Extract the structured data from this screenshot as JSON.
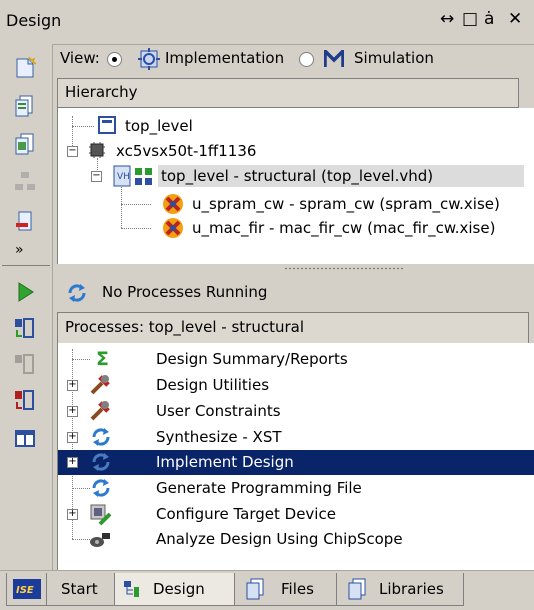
{
  "window": {
    "title": "Design",
    "controls": [
      "↔",
      "□",
      "ȧ",
      "✕"
    ]
  },
  "view": {
    "label": "View:",
    "implementation_label": "Implementation",
    "simulation_label": "Simulation",
    "selected": "Implementation"
  },
  "hierarchy": {
    "header": "Hierarchy",
    "items": [
      {
        "label": "top_level",
        "icon": "document-icon"
      },
      {
        "label": "xc5vsx50t-1ff1136",
        "icon": "chip-icon"
      },
      {
        "label": "top_level - structural (top_level.vhd)",
        "icon": "vhdl-module-icon",
        "selected": true
      },
      {
        "label": "u_spram_cw - spram_cw (spram_cw.xise)",
        "icon": "sysgen-core-icon"
      },
      {
        "label": "u_mac_fir - mac_fir_cw (mac_fir_cw.xise)",
        "icon": "sysgen-core-icon"
      }
    ]
  },
  "processes": {
    "status": "No Processes Running",
    "header": "Processes: top_level - structural",
    "items": [
      {
        "label": "Design Summary/Reports",
        "icon": "sigma-icon",
        "expandable": false
      },
      {
        "label": "Design Utilities",
        "icon": "tools-icon",
        "expandable": true
      },
      {
        "label": "User Constraints",
        "icon": "tools-icon",
        "expandable": true
      },
      {
        "label": "Synthesize - XST",
        "icon": "refresh-icon",
        "expandable": true
      },
      {
        "label": "Implement Design",
        "icon": "refresh-icon",
        "expandable": true,
        "selected": true
      },
      {
        "label": "Generate Programming File",
        "icon": "refresh-icon",
        "expandable": false
      },
      {
        "label": "Configure Target Device",
        "icon": "target-device-icon",
        "expandable": true
      },
      {
        "label": "Analyze Design Using ChipScope",
        "icon": "chipscope-icon",
        "expandable": false
      }
    ]
  },
  "tabs": [
    {
      "label": "",
      "icon": "ise-logo-icon"
    },
    {
      "label": "Start"
    },
    {
      "label": "Design",
      "active": true
    },
    {
      "label": "Files"
    },
    {
      "label": "Libraries"
    }
  ],
  "colors": {
    "panel_bg": "#d4d0c8",
    "selection_bg": "#0a246a",
    "selection_fg": "#ffffff",
    "hier_selection_bg": "#dcdcdc"
  }
}
